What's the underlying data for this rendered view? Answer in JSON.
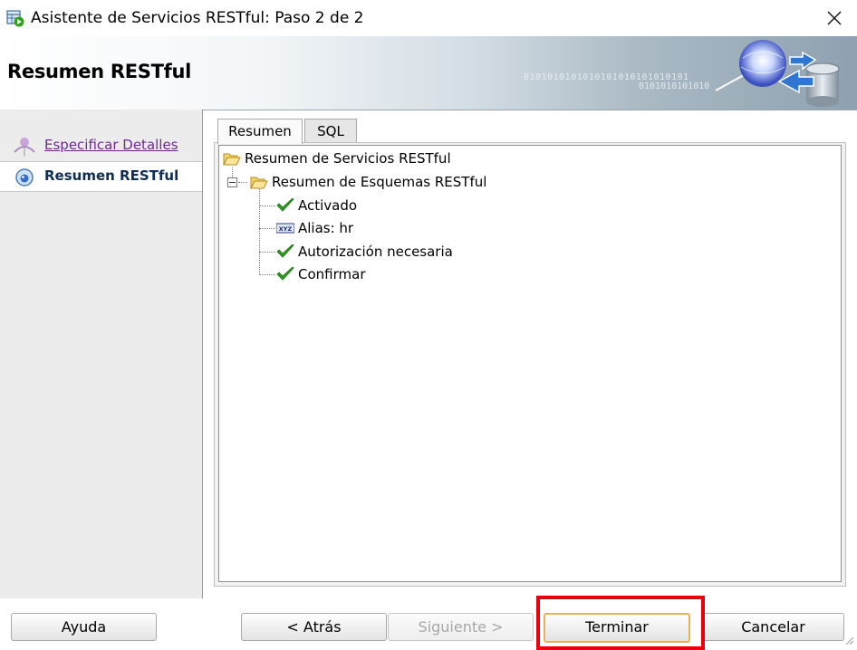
{
  "window": {
    "title": "Asistente de Servicios RESTful: Paso 2 de 2",
    "icons": {
      "app": "wizard-app-icon",
      "close": "close-icon"
    }
  },
  "banner": {
    "heading": "Resumen RESTful",
    "binary_line1": "0101010101010101010101010101",
    "binary_line2": "0101010101010"
  },
  "steps": [
    {
      "label": "Especificar Detalles",
      "state": "visited",
      "icon": "step-person-icon"
    },
    {
      "label": "Resumen RESTful",
      "state": "current",
      "icon": "step-current-icon"
    }
  ],
  "tabs": [
    {
      "label": "Resumen",
      "selected": true
    },
    {
      "label": "SQL",
      "selected": false
    }
  ],
  "tree": {
    "root": {
      "label": "Resumen de Servicios RESTful",
      "icon": "open-folder-icon"
    },
    "schema": {
      "label": "Resumen de Esquemas RESTful",
      "icon": "open-folder-icon",
      "expanded": true
    },
    "items": [
      {
        "label": "Activado",
        "icon": "check-icon"
      },
      {
        "label": "Alias: hr",
        "icon": "xyz-field-icon"
      },
      {
        "label": "Autorización necesaria",
        "icon": "check-icon"
      },
      {
        "label": "Confirmar",
        "icon": "check-icon"
      }
    ]
  },
  "buttons": {
    "help": "Ayuda",
    "back": "< Atrás",
    "next": "Siguiente >",
    "finish": "Terminar",
    "cancel": "Cancelar"
  },
  "colors": {
    "visited_link": "#6b2b8f",
    "current_step": "#0f2c52",
    "check": "#2e9e1f",
    "highlight": "#e8000a",
    "default_button_border": "#e8b25a"
  }
}
